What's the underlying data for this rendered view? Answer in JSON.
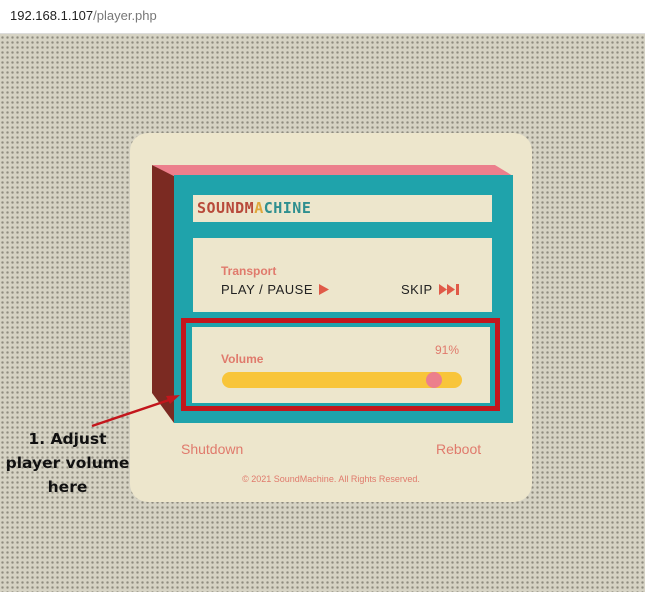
{
  "browser": {
    "url_host": "192.168.1.107",
    "url_path": "/player.php"
  },
  "app": {
    "brand": [
      "SOUNDM",
      "A",
      "CHINE"
    ]
  },
  "transport": {
    "label": "Transport",
    "play_pause_label": "PLAY / PAUSE",
    "skip_label": "SKIP"
  },
  "volume": {
    "label": "Volume",
    "display": "91%",
    "level": 0.91
  },
  "footer": {
    "shutdown_label": "Shutdown",
    "reboot_label": "Reboot",
    "copyright": "© 2021 SoundMachine. All Rights Reserved."
  },
  "annotation": {
    "lines": [
      "1. Adjust",
      "player volume",
      "here"
    ]
  },
  "colors": {
    "teal": "#1fa3ab",
    "cream": "#ede6cc",
    "salmon": "#e07a6c",
    "pink": "#ec7f8c",
    "yellow": "#f8c53a",
    "highlight_red": "#c3161c"
  },
  "icons": {
    "play": "play-triangle-icon",
    "skip": "skip-forward-icon"
  }
}
